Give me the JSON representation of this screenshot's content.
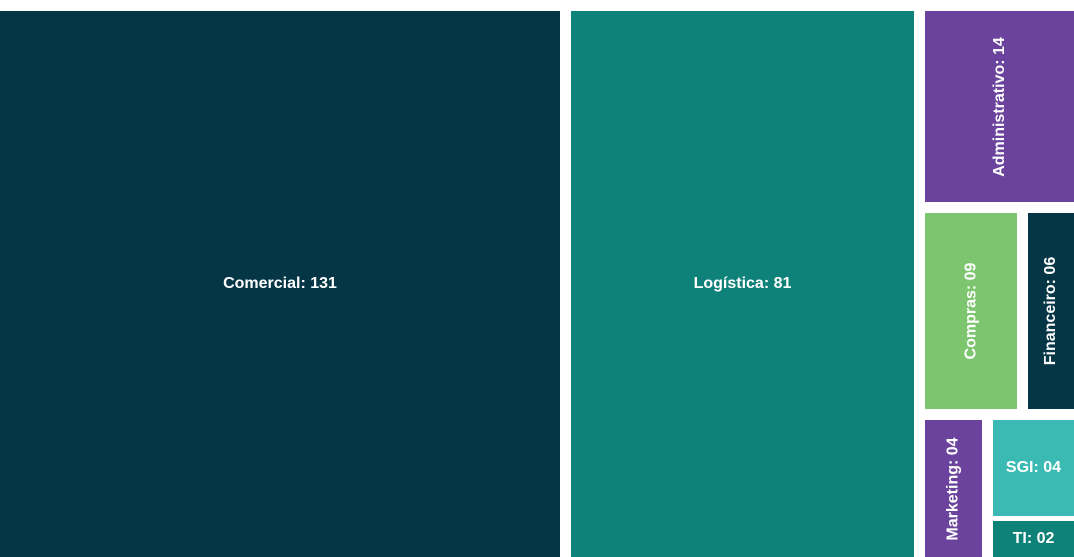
{
  "chart_data": {
    "type": "treemap",
    "separator": ": ",
    "items": [
      {
        "name": "Comercial",
        "value": 131,
        "display": "131",
        "color": "#053645"
      },
      {
        "name": "Logística",
        "value": 81,
        "display": "81",
        "color": "#0e8278"
      },
      {
        "name": "Administrativo",
        "value": 14,
        "display": "14",
        "color": "#6b439d"
      },
      {
        "name": "Compras",
        "value": 9,
        "display": "09",
        "color": "#7ec56f"
      },
      {
        "name": "Financeiro",
        "value": 6,
        "display": "06",
        "color": "#053645"
      },
      {
        "name": "Marketing",
        "value": 4,
        "display": "04",
        "color": "#6b439d"
      },
      {
        "name": "SGI",
        "value": 4,
        "display": "04",
        "color": "#3bbab3"
      },
      {
        "name": "TI",
        "value": 2,
        "display": "02",
        "color": "#0e8278"
      }
    ]
  }
}
